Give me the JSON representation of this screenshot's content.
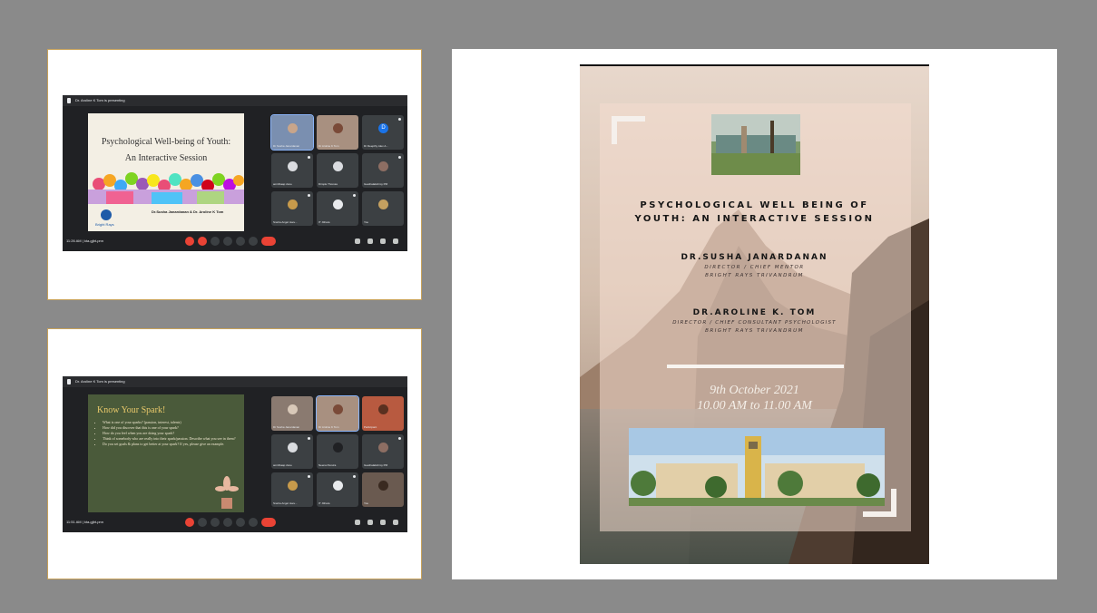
{
  "screenshot1": {
    "presenting": "Dr. Aroline K Tom is presenting",
    "slide_title_1": "Psychological Well-being of Youth:",
    "slide_title_2": "An Interactive Session",
    "slide_presenters": "Dr.Susha Janardanan & Dr. Aroline K Tom",
    "slide_org": "Bright Rays",
    "time": "11:26 AM",
    "meeting_code": "kta-gjbt-pnn",
    "participants": [
      {
        "name": "Dr Susha Janardanan"
      },
      {
        "name": "Dr Aroline K Tom"
      },
      {
        "name": "Dr Deepthy Alex A..."
      },
      {
        "name": "amrithaap done"
      },
      {
        "name": "Dimple Thomas"
      },
      {
        "name": "Geethalakshmy PM"
      },
      {
        "name": "Sneha Angel Jeev..."
      },
      {
        "name": "IT Jithara"
      },
      {
        "name": "You"
      }
    ],
    "avatar_letter": "D"
  },
  "screenshot2": {
    "presenting": "Dr. Aroline K Tom is presenting",
    "slide_title": "Know Your Spark!",
    "bullets": [
      "What is one of your sparks? (passion, interest, talents)",
      "How did you discover that this is one of your spark?",
      "How do you feel when you are doing your spark?",
      "Think of somebody who are really into their spark/passion. Describe what you see in them?",
      "Do you set goals & plans to get better at your spark? If yes, please give an example."
    ],
    "time": "11:51 AM",
    "meeting_code": "kta-gjbt-pnn",
    "participants": [
      {
        "name": "Dr Susha Janardanan"
      },
      {
        "name": "Dr Aroline K Tom"
      },
      {
        "name": "Participant"
      },
      {
        "name": "amrithaap done"
      },
      {
        "name": "Neena Pereira"
      },
      {
        "name": "Geethalakshmy PM"
      },
      {
        "name": "Sneha Angel Jeev..."
      },
      {
        "name": "IT Jithara"
      },
      {
        "name": "You"
      }
    ]
  },
  "poster": {
    "title_1": "PSYCHOLOGICAL WELL BEING OF",
    "title_2": "YOUTH: AN INTERACTIVE SESSION",
    "speaker1_name": "DR.SUSHA JANARDANAN",
    "speaker1_role_1": "DIRECTOR / CHIEF MENTOR",
    "speaker1_role_2": "BRIGHT RAYS TRIVANDRUM",
    "speaker2_name": "DR.AROLINE K. TOM",
    "speaker2_role_1": "DIRECTOR / CHIEF CONSULTANT PSYCHOLOGIST",
    "speaker2_role_2": "BRIGHT RAYS TRIVANDRUM",
    "date": "9th October 2021",
    "time": "10.00 AM to 11.00 AM"
  },
  "colors": {
    "page_bg": "#8a8a8a",
    "card_border": "#c8a25a",
    "meet_bg": "#202124",
    "end_call": "#ea4335",
    "slide2_bg": "#4a5a3a"
  }
}
